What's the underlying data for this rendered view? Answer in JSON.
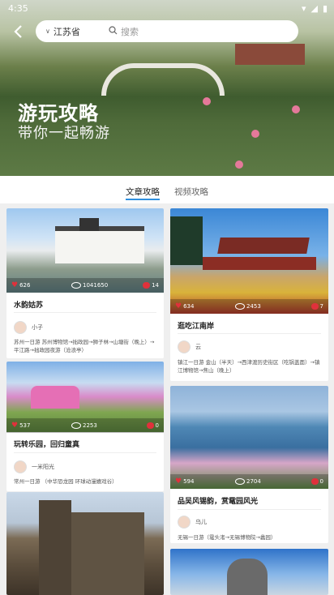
{
  "status": {
    "time": "4:35"
  },
  "header": {
    "province": "江苏省",
    "search_placeholder": "搜索",
    "hero_title": "游玩攻略",
    "hero_subtitle": "带你一起畅游"
  },
  "tabs": [
    {
      "label": "文章攻略",
      "active": true
    },
    {
      "label": "视频攻略",
      "active": false
    }
  ],
  "cards": [
    {
      "title": "水韵姑苏",
      "likes": "626",
      "views": "1041650",
      "comments": "14",
      "author": "小子",
      "route": "苏州一日游 苏州博物馆→拙政园→狮子林→山塘街（晚上）→平江路→拙政园夜游（沧浪亭）"
    },
    {
      "title": "逛吃江南岸",
      "likes": "634",
      "views": "2453",
      "comments": "7",
      "author": "云",
      "route": "镇江一日游 金山（半天）→西津渡历史街区（吃锅盖面）→镇江博物馆→焦山（晚上）"
    },
    {
      "title": "玩转乐园，回归童真",
      "likes": "537",
      "views": "2253",
      "comments": "0",
      "author": "一米阳光",
      "route": "常州一日游 （中华恐龙园 环球动漫嬉戏谷）"
    },
    {
      "title": "品吴风锡韵，赏鼋园风光",
      "likes": "594",
      "views": "2704",
      "comments": "0",
      "author": "乌儿",
      "route": "无锡一日游（鼋头渚→无锡博物院→蠡园）"
    }
  ],
  "colors": {
    "accent": "#2f8fde",
    "like": "#e0313b"
  }
}
